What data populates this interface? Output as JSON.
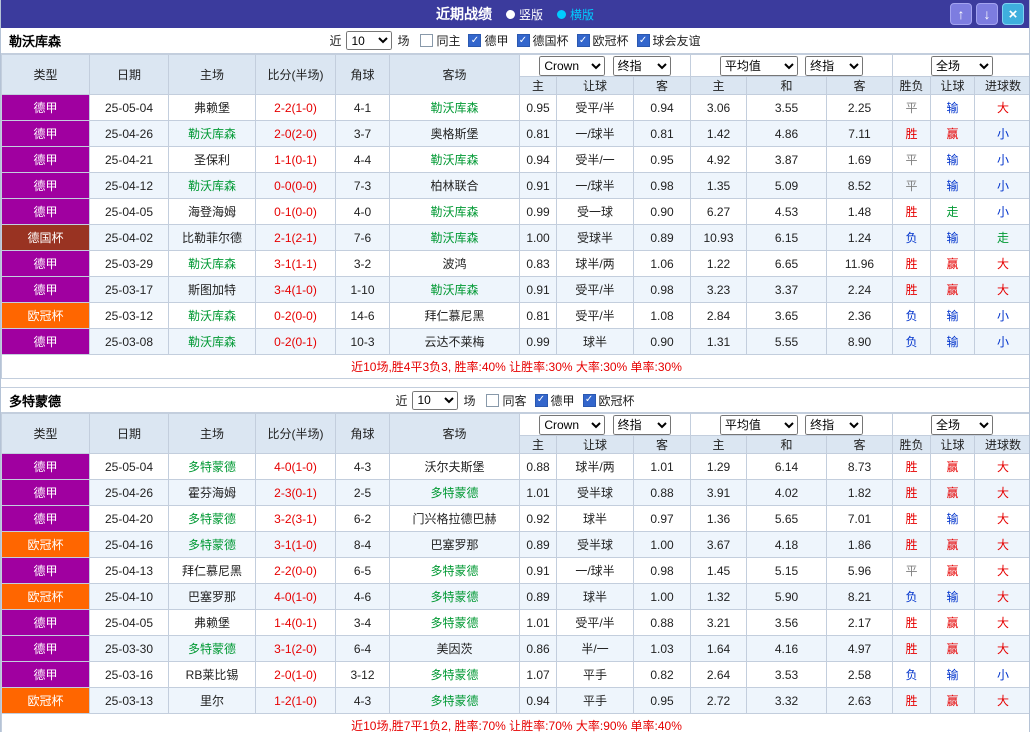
{
  "titlebar": {
    "title": "近期战绩",
    "vertical_label": "竖版",
    "horizontal_label": "横版",
    "up_glyph": "↑",
    "down_glyph": "↓",
    "close_glyph": "×"
  },
  "colors": {
    "type_colors": {
      "德甲": "#a000a0",
      "德国杯": "#993322",
      "欧冠杯": "#ff6600"
    },
    "team_color": "#009933",
    "score_color": "#e60000",
    "result_colors": {
      "胜": "#e60000",
      "平": "#808080",
      "负": "#0033cc"
    },
    "handicap_colors": {
      "赢": "#e60000",
      "走": "#009933",
      "输": "#0033cc"
    },
    "goal_colors": {
      "大": "#e60000",
      "走": "#009933",
      "小": "#0033cc"
    }
  },
  "sections": [
    {
      "team": "勒沃库森",
      "filter": {
        "near_label": "近",
        "count": "10",
        "games_label": "场",
        "checkboxes": [
          {
            "label": "同主",
            "checked": false
          },
          {
            "label": "德甲",
            "checked": true
          },
          {
            "label": "德国杯",
            "checked": true
          },
          {
            "label": "欧冠杯",
            "checked": true
          },
          {
            "label": "球会友谊",
            "checked": true
          }
        ]
      },
      "dropdowns": {
        "bookmaker": "Crown",
        "bookmaker_time": "终指",
        "average": "平均值",
        "average_time": "终指",
        "scope": "全场"
      },
      "columns": [
        "类型",
        "日期",
        "主场",
        "比分(半场)",
        "角球",
        "客场"
      ],
      "subcolumns": [
        "主",
        "让球",
        "客",
        "主",
        "和",
        "客",
        "胜负",
        "让球",
        "进球数"
      ],
      "rows": [
        {
          "type": "德甲",
          "date": "25-05-04",
          "home": "弗赖堡",
          "home_team": false,
          "score": "2-2(1-0)",
          "corner": "4-1",
          "away": "勒沃库森",
          "away_team": true,
          "odds": [
            "0.95",
            "受平/半",
            "0.94"
          ],
          "avg": [
            "3.06",
            "3.55",
            "2.25"
          ],
          "res": [
            "平",
            "输",
            "大"
          ]
        },
        {
          "type": "德甲",
          "date": "25-04-26",
          "home": "勒沃库森",
          "home_team": true,
          "score": "2-0(2-0)",
          "corner": "3-7",
          "away": "奥格斯堡",
          "away_team": false,
          "odds": [
            "0.81",
            "一/球半",
            "0.81"
          ],
          "avg": [
            "1.42",
            "4.86",
            "7.11"
          ],
          "res": [
            "胜",
            "赢",
            "小"
          ]
        },
        {
          "type": "德甲",
          "date": "25-04-21",
          "home": "圣保利",
          "home_team": false,
          "score": "1-1(0-1)",
          "corner": "4-4",
          "away": "勒沃库森",
          "away_team": true,
          "odds": [
            "0.94",
            "受半/一",
            "0.95"
          ],
          "avg": [
            "4.92",
            "3.87",
            "1.69"
          ],
          "res": [
            "平",
            "输",
            "小"
          ]
        },
        {
          "type": "德甲",
          "date": "25-04-12",
          "home": "勒沃库森",
          "home_team": true,
          "score": "0-0(0-0)",
          "corner": "7-3",
          "away": "柏林联合",
          "away_team": false,
          "odds": [
            "0.91",
            "一/球半",
            "0.98"
          ],
          "avg": [
            "1.35",
            "5.09",
            "8.52"
          ],
          "res": [
            "平",
            "输",
            "小"
          ]
        },
        {
          "type": "德甲",
          "date": "25-04-05",
          "home": "海登海姆",
          "home_team": false,
          "score": "0-1(0-0)",
          "corner": "4-0",
          "away": "勒沃库森",
          "away_team": true,
          "odds": [
            "0.99",
            "受一球",
            "0.90"
          ],
          "avg": [
            "6.27",
            "4.53",
            "1.48"
          ],
          "res": [
            "胜",
            "走",
            "小"
          ]
        },
        {
          "type": "德国杯",
          "date": "25-04-02",
          "home": "比勒菲尔德",
          "home_team": false,
          "score": "2-1(2-1)",
          "corner": "7-6",
          "away": "勒沃库森",
          "away_team": true,
          "odds": [
            "1.00",
            "受球半",
            "0.89"
          ],
          "avg": [
            "10.93",
            "6.15",
            "1.24"
          ],
          "res": [
            "负",
            "输",
            "走"
          ]
        },
        {
          "type": "德甲",
          "date": "25-03-29",
          "home": "勒沃库森",
          "home_team": true,
          "score": "3-1(1-1)",
          "corner": "3-2",
          "away": "波鸿",
          "away_team": false,
          "odds": [
            "0.83",
            "球半/两",
            "1.06"
          ],
          "avg": [
            "1.22",
            "6.65",
            "11.96"
          ],
          "res": [
            "胜",
            "赢",
            "大"
          ]
        },
        {
          "type": "德甲",
          "date": "25-03-17",
          "home": "斯图加特",
          "home_team": false,
          "score": "3-4(1-0)",
          "corner": "1-10",
          "away": "勒沃库森",
          "away_team": true,
          "odds": [
            "0.91",
            "受平/半",
            "0.98"
          ],
          "avg": [
            "3.23",
            "3.37",
            "2.24"
          ],
          "res": [
            "胜",
            "赢",
            "大"
          ]
        },
        {
          "type": "欧冠杯",
          "date": "25-03-12",
          "home": "勒沃库森",
          "home_team": true,
          "score": "0-2(0-0)",
          "corner": "14-6",
          "away": "拜仁慕尼黑",
          "away_team": false,
          "odds": [
            "0.81",
            "受平/半",
            "1.08"
          ],
          "avg": [
            "2.84",
            "3.65",
            "2.36"
          ],
          "res": [
            "负",
            "输",
            "小"
          ]
        },
        {
          "type": "德甲",
          "date": "25-03-08",
          "home": "勒沃库森",
          "home_team": true,
          "score": "0-2(0-1)",
          "corner": "10-3",
          "away": "云达不莱梅",
          "away_team": false,
          "odds": [
            "0.99",
            "球半",
            "0.90"
          ],
          "avg": [
            "1.31",
            "5.55",
            "8.90"
          ],
          "res": [
            "负",
            "输",
            "小"
          ]
        }
      ],
      "summary": "近10场,胜4平3负3, 胜率:40% 让胜率:30% 大率:30% 单率:30%"
    },
    {
      "team": "多特蒙德",
      "filter": {
        "near_label": "近",
        "count": "10",
        "games_label": "场",
        "checkboxes": [
          {
            "label": "同客",
            "checked": false
          },
          {
            "label": "德甲",
            "checked": true
          },
          {
            "label": "欧冠杯",
            "checked": true
          }
        ]
      },
      "dropdowns": {
        "bookmaker": "Crown",
        "bookmaker_time": "终指",
        "average": "平均值",
        "average_time": "终指",
        "scope": "全场"
      },
      "columns": [
        "类型",
        "日期",
        "主场",
        "比分(半场)",
        "角球",
        "客场"
      ],
      "subcolumns": [
        "主",
        "让球",
        "客",
        "主",
        "和",
        "客",
        "胜负",
        "让球",
        "进球数"
      ],
      "rows": [
        {
          "type": "德甲",
          "date": "25-05-04",
          "home": "多特蒙德",
          "home_team": true,
          "score": "4-0(1-0)",
          "corner": "4-3",
          "away": "沃尔夫斯堡",
          "away_team": false,
          "odds": [
            "0.88",
            "球半/两",
            "1.01"
          ],
          "avg": [
            "1.29",
            "6.14",
            "8.73"
          ],
          "res": [
            "胜",
            "赢",
            "大"
          ]
        },
        {
          "type": "德甲",
          "date": "25-04-26",
          "home": "霍芬海姆",
          "home_team": false,
          "score": "2-3(0-1)",
          "corner": "2-5",
          "away": "多特蒙德",
          "away_team": true,
          "odds": [
            "1.01",
            "受半球",
            "0.88"
          ],
          "avg": [
            "3.91",
            "4.02",
            "1.82"
          ],
          "res": [
            "胜",
            "赢",
            "大"
          ]
        },
        {
          "type": "德甲",
          "date": "25-04-20",
          "home": "多特蒙德",
          "home_team": true,
          "score": "3-2(3-1)",
          "corner": "6-2",
          "away": "门兴格拉德巴赫",
          "away_team": false,
          "odds": [
            "0.92",
            "球半",
            "0.97"
          ],
          "avg": [
            "1.36",
            "5.65",
            "7.01"
          ],
          "res": [
            "胜",
            "输",
            "大"
          ]
        },
        {
          "type": "欧冠杯",
          "date": "25-04-16",
          "home": "多特蒙德",
          "home_team": true,
          "score": "3-1(1-0)",
          "corner": "8-4",
          "away": "巴塞罗那",
          "away_team": false,
          "odds": [
            "0.89",
            "受半球",
            "1.00"
          ],
          "avg": [
            "3.67",
            "4.18",
            "1.86"
          ],
          "res": [
            "胜",
            "赢",
            "大"
          ]
        },
        {
          "type": "德甲",
          "date": "25-04-13",
          "home": "拜仁慕尼黑",
          "home_team": false,
          "score": "2-2(0-0)",
          "corner": "6-5",
          "away": "多特蒙德",
          "away_team": true,
          "odds": [
            "0.91",
            "一/球半",
            "0.98"
          ],
          "avg": [
            "1.45",
            "5.15",
            "5.96"
          ],
          "res": [
            "平",
            "赢",
            "大"
          ]
        },
        {
          "type": "欧冠杯",
          "date": "25-04-10",
          "home": "巴塞罗那",
          "home_team": false,
          "score": "4-0(1-0)",
          "corner": "4-6",
          "away": "多特蒙德",
          "away_team": true,
          "odds": [
            "0.89",
            "球半",
            "1.00"
          ],
          "avg": [
            "1.32",
            "5.90",
            "8.21"
          ],
          "res": [
            "负",
            "输",
            "大"
          ]
        },
        {
          "type": "德甲",
          "date": "25-04-05",
          "home": "弗赖堡",
          "home_team": false,
          "score": "1-4(0-1)",
          "corner": "3-4",
          "away": "多特蒙德",
          "away_team": true,
          "odds": [
            "1.01",
            "受平/半",
            "0.88"
          ],
          "avg": [
            "3.21",
            "3.56",
            "2.17"
          ],
          "res": [
            "胜",
            "赢",
            "大"
          ]
        },
        {
          "type": "德甲",
          "date": "25-03-30",
          "home": "多特蒙德",
          "home_team": true,
          "score": "3-1(2-0)",
          "corner": "6-4",
          "away": "美因茨",
          "away_team": false,
          "odds": [
            "0.86",
            "半/一",
            "1.03"
          ],
          "avg": [
            "1.64",
            "4.16",
            "4.97"
          ],
          "res": [
            "胜",
            "赢",
            "大"
          ]
        },
        {
          "type": "德甲",
          "date": "25-03-16",
          "home": "RB莱比锡",
          "home_team": false,
          "score": "2-0(1-0)",
          "corner": "3-12",
          "away": "多特蒙德",
          "away_team": true,
          "odds": [
            "1.07",
            "平手",
            "0.82"
          ],
          "avg": [
            "2.64",
            "3.53",
            "2.58"
          ],
          "res": [
            "负",
            "输",
            "小"
          ]
        },
        {
          "type": "欧冠杯",
          "date": "25-03-13",
          "home": "里尔",
          "home_team": false,
          "score": "1-2(1-0)",
          "corner": "4-3",
          "away": "多特蒙德",
          "away_team": true,
          "odds": [
            "0.94",
            "平手",
            "0.95"
          ],
          "avg": [
            "2.72",
            "3.32",
            "2.63"
          ],
          "res": [
            "胜",
            "赢",
            "大"
          ]
        }
      ],
      "summary": "近10场,胜7平1负2, 胜率:70% 让胜率:70% 大率:90% 单率:40%"
    }
  ]
}
